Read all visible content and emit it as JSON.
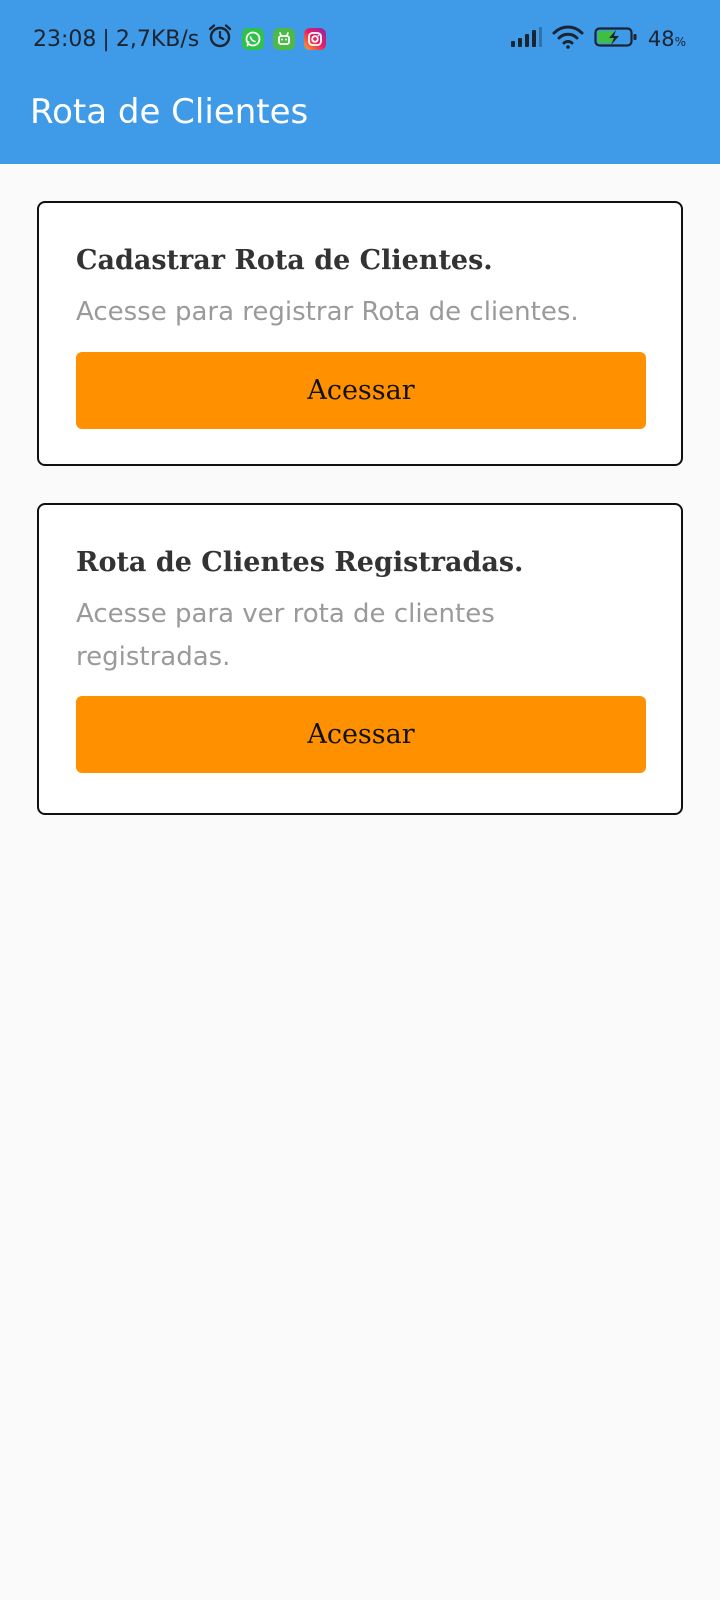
{
  "status_bar": {
    "time": "23:08",
    "separator": "|",
    "network_speed": "2,7KB/s",
    "left_icons": [
      "alarm-icon",
      "whatsapp-icon",
      "android-icon",
      "instagram-icon"
    ],
    "right_icons": [
      "signal-icon",
      "wifi-icon",
      "battery-charging-icon"
    ],
    "battery_value": "48",
    "battery_unit": "%"
  },
  "app_bar": {
    "title": "Rota de Clientes"
  },
  "cards": [
    {
      "title": "Cadastrar Rota de Clientes.",
      "description": "Acesse para registrar Rota de clientes.",
      "button_label": "Acessar"
    },
    {
      "title": "Rota de Clientes Registradas.",
      "description": "Acesse para ver rota de clientes registradas.",
      "button_label": "Acessar"
    }
  ],
  "colors": {
    "app_bar": "#3F9AE8",
    "button": "#FF9000",
    "background": "#FAFAFA",
    "card_border": "#111111",
    "title_text": "#333333",
    "description_text": "#9A9A9A"
  }
}
